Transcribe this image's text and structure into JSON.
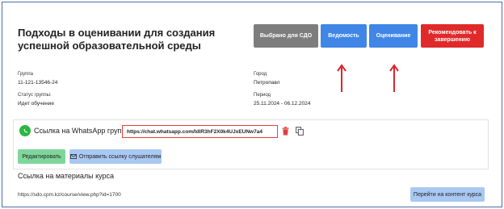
{
  "header": {
    "title": "Подходы в оценивании для создания успешной образовательной среды",
    "buttons": {
      "selected": "Выбрано для СДО",
      "gradebook": "Ведомость",
      "assessment": "Оценивание",
      "recommend": "Рекомендовать к завершению"
    }
  },
  "info": {
    "group_label": "Группа",
    "group_value": "11-121-13546-24",
    "status_label": "Статус группы:",
    "status_value": "Идет обучение",
    "city_label": "Город",
    "city_value": "Петропавл",
    "period_label": "Период",
    "period_value": "25.11.2024 - 06.12.2024"
  },
  "whatsapp": {
    "label": "Ссылка на WhatsApp группу",
    "link_value": "https://chat.whatsapp.com/IdlR3hF2X0k4UJxEUNw7a4",
    "edit_label": "Редактировать",
    "send_label": "Отправить ссылку слушателям"
  },
  "materials": {
    "title": "Ссылка на материалы курса",
    "url": "https://sdo.cpm.kz/course/view.php?id=1700",
    "go_label": "Перейти на контент курса"
  },
  "colors": {
    "accent_blue": "#3f86e6",
    "danger_red": "#e02a2a",
    "whatsapp_green": "#2bb741",
    "annotation_arrow": "#d9262b"
  }
}
